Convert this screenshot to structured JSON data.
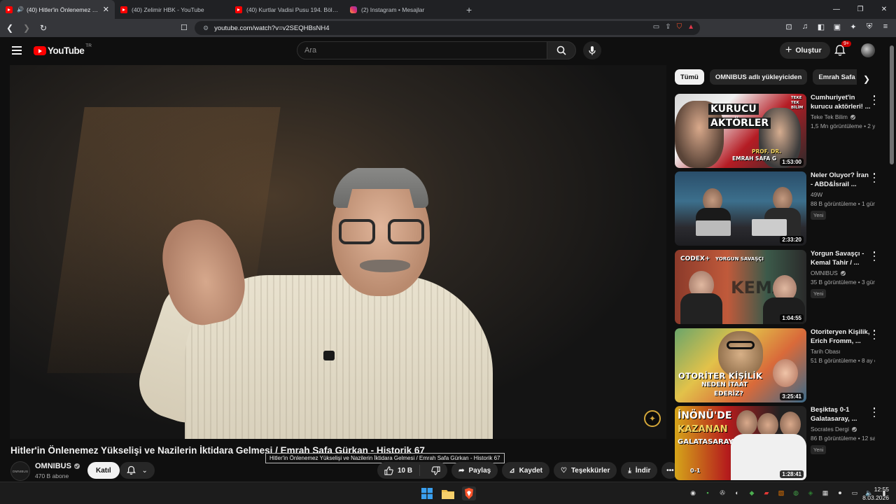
{
  "browser": {
    "tabs": [
      {
        "title": "(40) Hitler'in Önlenemez Yükse",
        "active": true,
        "icon": "youtube-icon"
      },
      {
        "title": "(40) Zelimir HBK - YouTube",
        "active": false,
        "icon": "youtube-icon"
      },
      {
        "title": "(40) Kurtlar Vadisi Pusu 194. Bölüm -",
        "active": false,
        "icon": "youtube-icon"
      },
      {
        "title": "(2) Instagram • Mesajlar",
        "active": false,
        "icon": "instagram-icon"
      }
    ],
    "new_tab": "+",
    "url": "youtube.com/watch?v=v2SEQHBsNH4"
  },
  "youtube": {
    "logo_text": "YouTube",
    "country_code": "TR",
    "search_placeholder": "Ara",
    "create_label": "Oluştur",
    "notification_count": "9+"
  },
  "video": {
    "title": "Hitler'in Önlenemez Yükselişi ve Nazilerin İktidara Gelmesi / Emrah Safa Gürkan - Historik 67",
    "tooltip": "Hitler'in Önlenemez Yükselişi ve Nazilerin İktidara Gelmesi / Emrah Safa Gürkan - Historik 67",
    "channel": "OMNIBUS",
    "channel_avatar_text": "OMNIBUS",
    "subscribers": "470 B abone",
    "join_label": "Katıl",
    "likes": "10 B",
    "share_label": "Paylaş",
    "save_label": "Kaydet",
    "thanks_label": "Teşekkürler",
    "download_label": "İndir"
  },
  "chips": [
    "Tümü",
    "OMNIBUS adlı yükleyiciden",
    "Emrah Safa Gürkan"
  ],
  "recommendations": [
    {
      "title": "Cumhuriyet'in kurucu aktörleri! ...",
      "channel": "Teke Tek Bilim",
      "verified": true,
      "meta": "1,5 Mn görüntüleme • 2 yıl önce",
      "duration": "1:53:00",
      "new": "",
      "thumb_text": [
        "KURUCU",
        "AKTÖRLER",
        "PROF. DR.",
        "EMRAH SAFA G",
        "TEKE",
        "TEK",
        "BİLİM"
      ]
    },
    {
      "title": "Neler Oluyor? İran - ABD&İsrail ...",
      "channel": "49W",
      "verified": false,
      "meta": "88 B görüntüleme • 1 gün önce",
      "duration": "2:33:20",
      "new": "Yeni",
      "thumb_text": []
    },
    {
      "title": "Yorgun Savaşçı - Kemal Tahir / ...",
      "channel": "OMNIBUS",
      "verified": true,
      "meta": "35 B görüntüleme • 3 gün önce",
      "duration": "1:04:55",
      "new": "Yeni",
      "thumb_text": [
        "CODEX+",
        "YORGUN SAVAŞÇI",
        "KEMAL"
      ]
    },
    {
      "title": "Otoriteryen Kişilik, Erich Fromm, ...",
      "channel": "Tarih Obası",
      "verified": false,
      "meta": "51 B görüntüleme • 8 ay önce",
      "duration": "3:25:41",
      "new": "",
      "thumb_text": [
        "OTORİTER KİŞİLİK",
        "NEDEN İTAAT",
        "EDERİZ?"
      ]
    },
    {
      "title": "Beşiktaş 0-1 Galatasaray, ...",
      "channel": "Socrates Dergi",
      "verified": true,
      "meta": "86 B görüntüleme • 12 saat önce",
      "duration": "1:28:41",
      "new": "Yeni",
      "thumb_text": [
        "İNÖNÜ'DE",
        "KAZANAN",
        "GALATASARAY",
        "0-1"
      ]
    }
  ],
  "taskbar": {
    "time": "12:55",
    "date": "8.03.2026"
  },
  "colors": {
    "yt_red": "#ff0000",
    "page_bg": "#0f0f0f",
    "pill_bg": "#272727"
  }
}
